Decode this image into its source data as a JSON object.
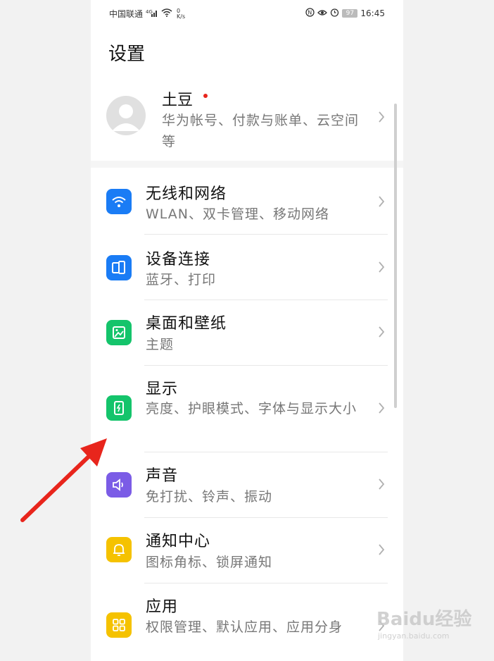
{
  "status_bar": {
    "carrier": "中国联通",
    "net_speed_value": "0",
    "net_speed_unit": "K/s",
    "battery": "97",
    "time": "16:45"
  },
  "header": {
    "title": "设置"
  },
  "account": {
    "name": "土豆",
    "subtitle": "华为帐号、付款与账单、云空间等"
  },
  "settings": [
    {
      "title": "无线和网络",
      "subtitle": "WLAN、双卡管理、移动网络",
      "icon": "wifi-icon",
      "color": "#1a7cf5"
    },
    {
      "title": "设备连接",
      "subtitle": "蓝牙、打印",
      "icon": "device-connection-icon",
      "color": "#1a7cf5"
    },
    {
      "title": "桌面和壁纸",
      "subtitle": "主题",
      "icon": "wallpaper-icon",
      "color": "#14c46b"
    },
    {
      "title": "显示",
      "subtitle": "亮度、护眼模式、字体与显示大小",
      "icon": "display-icon",
      "color": "#14c46b"
    },
    {
      "title": "声音",
      "subtitle": "免打扰、铃声、振动",
      "icon": "sound-icon",
      "color": "#7b5ce6"
    },
    {
      "title": "通知中心",
      "subtitle": "图标角标、锁屏通知",
      "icon": "bell-icon",
      "color": "#f5c200"
    },
    {
      "title": "应用",
      "subtitle": "权限管理、默认应用、应用分身",
      "icon": "apps-grid-icon",
      "color": "#f5c200"
    }
  ],
  "watermark": {
    "logo": "Baidu经验",
    "url": "jingyan.baidu.com"
  },
  "annotation_color": "#e8251c"
}
